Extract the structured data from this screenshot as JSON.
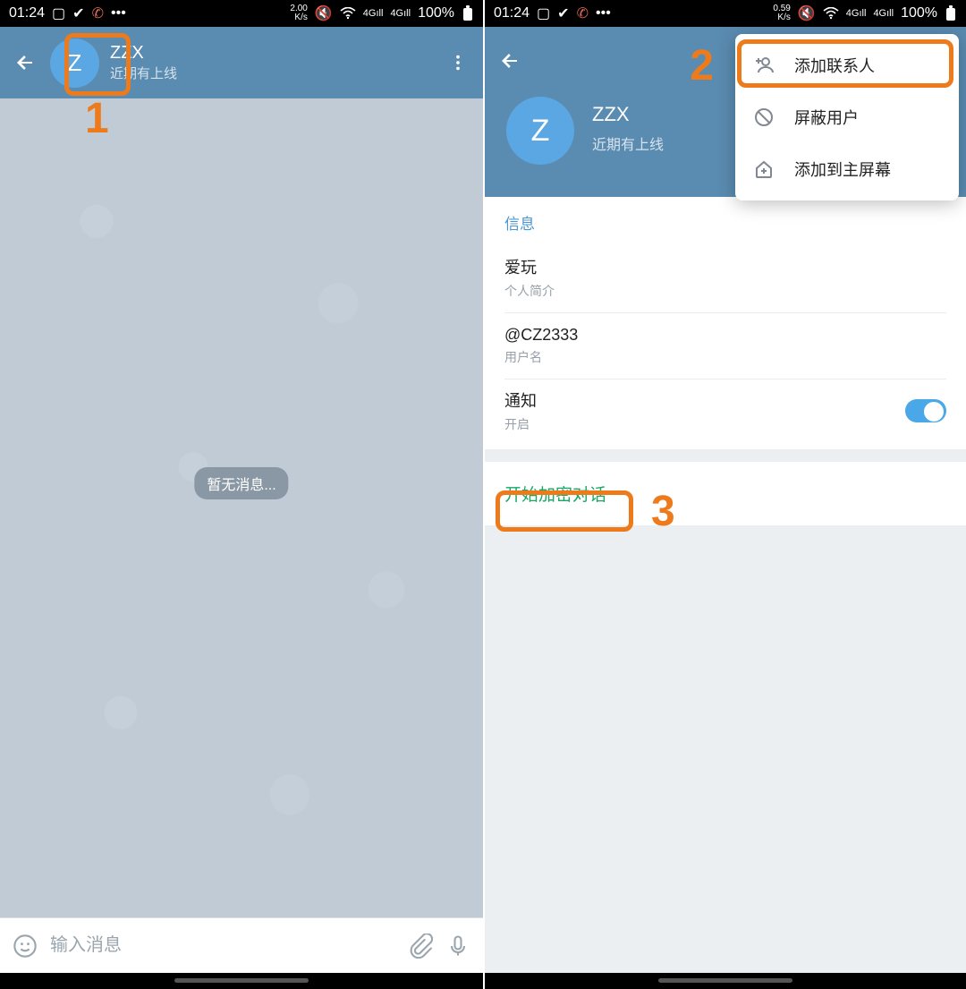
{
  "status": {
    "time": "01:24",
    "speed_left": "2.00",
    "speed_right": "0.59",
    "speed_unit": "K/s",
    "net": "4G",
    "battery": "100%"
  },
  "screen1": {
    "avatar_letter": "Z",
    "name": "ZZX",
    "status": "近期有上线",
    "no_messages": "暂无消息...",
    "input_placeholder": "输入消息"
  },
  "screen2": {
    "avatar_letter": "Z",
    "name": "ZZX",
    "status": "近期有上线",
    "menu": {
      "add_contact": "添加联系人",
      "block_user": "屏蔽用户",
      "add_home": "添加到主屏幕"
    },
    "info_title": "信息",
    "bio_value": "爱玩",
    "bio_label": "个人简介",
    "username_value": "@CZ2333",
    "username_label": "用户名",
    "notif_title": "通知",
    "notif_state": "开启",
    "secret_chat": "开始加密对话"
  },
  "annotations": {
    "n1": "1",
    "n2": "2",
    "n3": "3"
  }
}
